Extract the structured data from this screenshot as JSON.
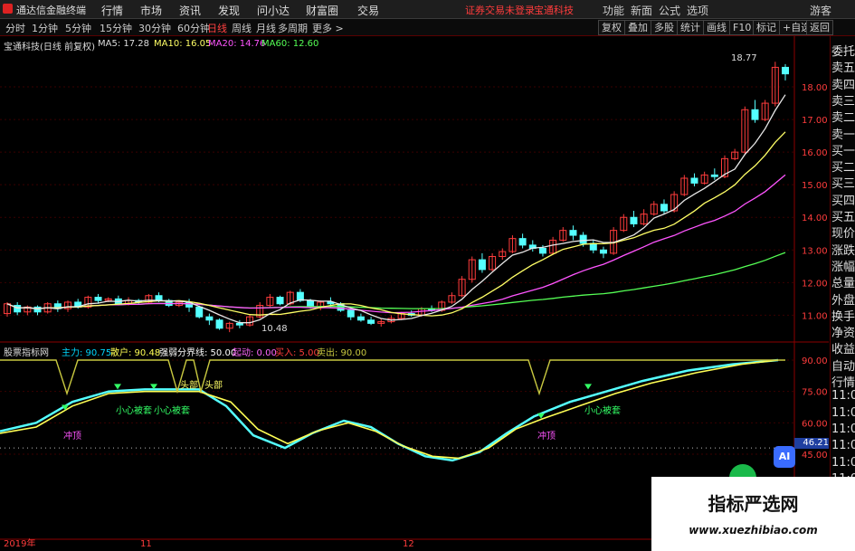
{
  "app": {
    "title": "通达信金融终端",
    "menus": [
      "行情",
      "市场",
      "资讯",
      "发现",
      "问小达",
      "财富圈",
      "交易"
    ],
    "notice": "证券交易未登录",
    "broker": "宝通科技",
    "window_buttons": [
      "功能",
      "新面",
      "公式",
      "选项",
      "游客"
    ]
  },
  "tabs": {
    "periods": [
      "分时",
      "1分钟",
      "5分钟",
      "15分钟",
      "30分钟",
      "60分钟",
      "日线",
      "周线",
      "月线",
      "多周期",
      "更多 >"
    ],
    "active": "日线",
    "right_tools": [
      "复权",
      "叠加",
      "多股",
      "统计",
      "画线",
      "F10",
      "标记",
      "+自选",
      "返回"
    ]
  },
  "stock": {
    "name_label": "宝通科技(日线 前复权)",
    "ma5": "MA5: 17.28",
    "ma10": "MA10: 16.05",
    "ma20": "MA20: 14.76",
    "ma60": "MA60: 12.60",
    "high_marker": "18.77",
    "low_marker": "10.48"
  },
  "indicator": {
    "name": "股票指标网",
    "values": [
      {
        "label": "主力: 90.75",
        "color": "#00d8ff"
      },
      {
        "label": "散户: 90.48",
        "color": "#ffff55"
      },
      {
        "label": "强弱分界线: 50.00",
        "color": "#ffffff"
      },
      {
        "label": "起动: 0.00",
        "color": "#ff66ff"
      },
      {
        "label": "买入: 5.00",
        "color": "#ff3c3c"
      },
      {
        "label": "卖出: 90.00",
        "color": "#c8c840"
      }
    ],
    "annotations": [
      "小心被套",
      "小心被套",
      "头部",
      "头部",
      "冲顶",
      "冲顶",
      "小心被套"
    ],
    "current_marker": "46.21"
  },
  "axes": {
    "price_ticks": [
      "18.00",
      "17.00",
      "16.00",
      "15.00",
      "14.00",
      "13.00",
      "12.00",
      "11.00"
    ],
    "ind_ticks": [
      "90.00",
      "75.00",
      "60.00",
      "45.00"
    ],
    "date_labels": [
      "2019年",
      "11",
      "12"
    ]
  },
  "side_panel": {
    "items": [
      "委托",
      "卖五",
      "卖四",
      "卖三",
      "卖二",
      "卖一",
      "买一",
      "买二",
      "买三",
      "买四",
      "买五",
      "现价",
      "涨跌",
      "涨幅",
      "总量",
      "外盘",
      "换手",
      "净资",
      "收益",
      "自动",
      "行情",
      "11:0",
      "11:0",
      "11:0",
      "11:0",
      "11:0",
      "11:0",
      "11:0",
      "11:0",
      "11:0"
    ]
  },
  "watermark": {
    "cn": "指标严选网",
    "url": "www.xuezhibiao.com"
  },
  "ai_label": "AI",
  "chart_data": {
    "type": "candlestick",
    "ylim": [
      10.4,
      19.0
    ],
    "candles": [
      [
        11.05,
        11.35,
        10.95,
        11.4
      ],
      [
        11.3,
        11.1,
        11.0,
        11.4
      ],
      [
        11.1,
        11.25,
        11.0,
        11.3
      ],
      [
        11.25,
        11.1,
        11.0,
        11.3
      ],
      [
        11.1,
        11.35,
        11.05,
        11.4
      ],
      [
        11.35,
        11.2,
        11.1,
        11.45
      ],
      [
        11.2,
        11.4,
        11.1,
        11.45
      ],
      [
        11.4,
        11.25,
        11.2,
        11.5
      ],
      [
        11.25,
        11.55,
        11.2,
        11.6
      ],
      [
        11.55,
        11.45,
        11.35,
        11.65
      ],
      [
        11.45,
        11.5,
        11.4,
        11.55
      ],
      [
        11.5,
        11.35,
        11.3,
        11.6
      ],
      [
        11.35,
        11.45,
        11.3,
        11.55
      ],
      [
        11.45,
        11.4,
        11.35,
        11.5
      ],
      [
        11.4,
        11.6,
        11.35,
        11.65
      ],
      [
        11.6,
        11.45,
        11.4,
        11.7
      ],
      [
        11.45,
        11.3,
        11.25,
        11.5
      ],
      [
        11.3,
        11.4,
        11.25,
        11.45
      ],
      [
        11.4,
        11.25,
        11.1,
        11.5
      ],
      [
        11.25,
        10.95,
        10.9,
        11.3
      ],
      [
        10.95,
        10.85,
        10.7,
        11.05
      ],
      [
        10.85,
        10.6,
        10.55,
        10.9
      ],
      [
        10.6,
        10.75,
        10.48,
        10.8
      ],
      [
        10.75,
        10.7,
        10.6,
        10.85
      ],
      [
        10.7,
        10.95,
        10.65,
        11.0
      ],
      [
        10.95,
        11.3,
        10.9,
        11.4
      ],
      [
        11.3,
        11.55,
        11.25,
        11.65
      ],
      [
        11.55,
        11.35,
        11.3,
        11.6
      ],
      [
        11.35,
        11.7,
        11.3,
        11.75
      ],
      [
        11.7,
        11.45,
        11.4,
        11.8
      ],
      [
        11.45,
        11.25,
        11.2,
        11.5
      ],
      [
        11.25,
        11.4,
        11.15,
        11.45
      ],
      [
        11.4,
        11.35,
        11.25,
        11.55
      ],
      [
        11.35,
        11.15,
        11.1,
        11.4
      ],
      [
        11.15,
        10.95,
        10.85,
        11.2
      ],
      [
        10.95,
        10.85,
        10.8,
        11.05
      ],
      [
        10.85,
        10.75,
        10.7,
        10.95
      ],
      [
        10.75,
        10.8,
        10.65,
        10.9
      ],
      [
        10.8,
        10.9,
        10.75,
        11.0
      ],
      [
        10.9,
        11.05,
        10.85,
        11.1
      ],
      [
        11.05,
        11.0,
        10.95,
        11.15
      ],
      [
        11.0,
        11.2,
        10.95,
        11.25
      ],
      [
        11.2,
        11.15,
        11.1,
        11.3
      ],
      [
        11.15,
        11.4,
        11.1,
        11.45
      ],
      [
        11.4,
        11.6,
        11.35,
        11.7
      ],
      [
        11.6,
        12.1,
        11.55,
        12.2
      ],
      [
        12.1,
        12.7,
        12.0,
        12.8
      ],
      [
        12.7,
        12.4,
        12.3,
        12.9
      ],
      [
        12.4,
        12.8,
        12.35,
        12.9
      ],
      [
        12.8,
        12.95,
        12.7,
        13.05
      ],
      [
        12.95,
        13.35,
        12.9,
        13.45
      ],
      [
        13.35,
        13.15,
        13.05,
        13.5
      ],
      [
        13.15,
        13.05,
        12.95,
        13.3
      ],
      [
        13.05,
        12.9,
        12.8,
        13.15
      ],
      [
        12.9,
        13.3,
        12.85,
        13.4
      ],
      [
        13.3,
        13.6,
        13.25,
        13.7
      ],
      [
        13.6,
        13.45,
        13.3,
        13.75
      ],
      [
        13.45,
        13.2,
        13.1,
        13.55
      ],
      [
        13.2,
        13.0,
        12.9,
        13.3
      ],
      [
        13.0,
        12.9,
        12.75,
        13.1
      ],
      [
        12.9,
        13.6,
        12.85,
        13.7
      ],
      [
        13.6,
        14.0,
        13.55,
        14.1
      ],
      [
        14.0,
        13.8,
        13.7,
        14.2
      ],
      [
        13.8,
        14.1,
        13.75,
        14.25
      ],
      [
        14.1,
        14.4,
        14.05,
        14.5
      ],
      [
        14.4,
        14.2,
        14.1,
        14.55
      ],
      [
        14.2,
        14.7,
        14.15,
        14.8
      ],
      [
        14.7,
        15.2,
        14.65,
        15.3
      ],
      [
        15.2,
        15.05,
        14.95,
        15.35
      ],
      [
        15.05,
        15.3,
        15.0,
        15.4
      ],
      [
        15.3,
        15.25,
        15.15,
        15.5
      ],
      [
        15.25,
        15.8,
        15.2,
        15.9
      ],
      [
        15.8,
        16.0,
        15.75,
        16.1
      ],
      [
        16.0,
        17.3,
        15.95,
        17.4
      ],
      [
        17.3,
        17.0,
        16.9,
        17.6
      ],
      [
        17.0,
        17.5,
        16.95,
        17.6
      ],
      [
        17.5,
        18.6,
        17.4,
        18.77
      ],
      [
        18.6,
        18.4,
        18.2,
        18.7
      ]
    ]
  }
}
